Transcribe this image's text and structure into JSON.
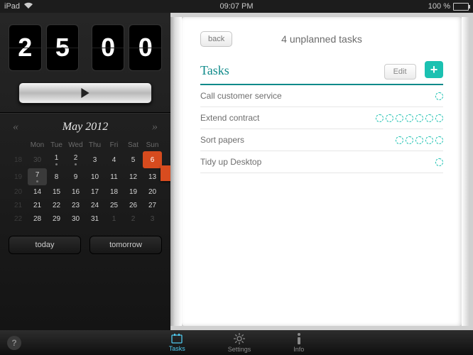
{
  "statusbar": {
    "device": "iPad",
    "time": "09:07 PM",
    "battery_pct": "100 %"
  },
  "timer": {
    "minutes": "25",
    "seconds": "00"
  },
  "calendar": {
    "month_label": "May 2012",
    "days": [
      "Mon",
      "Tue",
      "Wed",
      "Thu",
      "Fri",
      "Sat",
      "Sun"
    ],
    "weeks": [
      {
        "wk": "18",
        "cells": [
          {
            "n": "30",
            "dim": true
          },
          {
            "n": "1",
            "dot": true
          },
          {
            "n": "2",
            "dot": true
          },
          {
            "n": "3"
          },
          {
            "n": "4"
          },
          {
            "n": "5"
          },
          {
            "n": "6",
            "mark": true
          }
        ]
      },
      {
        "wk": "19",
        "cells": [
          {
            "n": "7",
            "today": true,
            "dot": true
          },
          {
            "n": "8"
          },
          {
            "n": "9"
          },
          {
            "n": "10"
          },
          {
            "n": "11"
          },
          {
            "n": "12"
          },
          {
            "n": "13"
          }
        ]
      },
      {
        "wk": "20",
        "cells": [
          {
            "n": "14"
          },
          {
            "n": "15"
          },
          {
            "n": "16"
          },
          {
            "n": "17"
          },
          {
            "n": "18"
          },
          {
            "n": "19"
          },
          {
            "n": "20"
          }
        ]
      },
      {
        "wk": "21",
        "cells": [
          {
            "n": "21"
          },
          {
            "n": "22"
          },
          {
            "n": "23"
          },
          {
            "n": "24"
          },
          {
            "n": "25"
          },
          {
            "n": "26"
          },
          {
            "n": "27"
          }
        ]
      },
      {
        "wk": "22",
        "cells": [
          {
            "n": "28"
          },
          {
            "n": "29"
          },
          {
            "n": "30"
          },
          {
            "n": "31"
          },
          {
            "n": "1",
            "dim": true
          },
          {
            "n": "2",
            "dim": true
          },
          {
            "n": "3",
            "dim": true
          }
        ]
      }
    ],
    "today_btn": "today",
    "tomorrow_btn": "tomorrow"
  },
  "notebook": {
    "back_label": "back",
    "page_title": "4 unplanned tasks",
    "section_title": "Tasks",
    "edit_label": "Edit",
    "tasks": [
      {
        "name": "Call customer service",
        "pomodoros": 1
      },
      {
        "name": "Extend contract",
        "pomodoros": 7
      },
      {
        "name": "Sort papers",
        "pomodoros": 5
      },
      {
        "name": "Tidy up Desktop",
        "pomodoros": 1
      }
    ]
  },
  "tabbar": {
    "tasks": "Tasks",
    "settings": "Settings",
    "info": "Info"
  }
}
